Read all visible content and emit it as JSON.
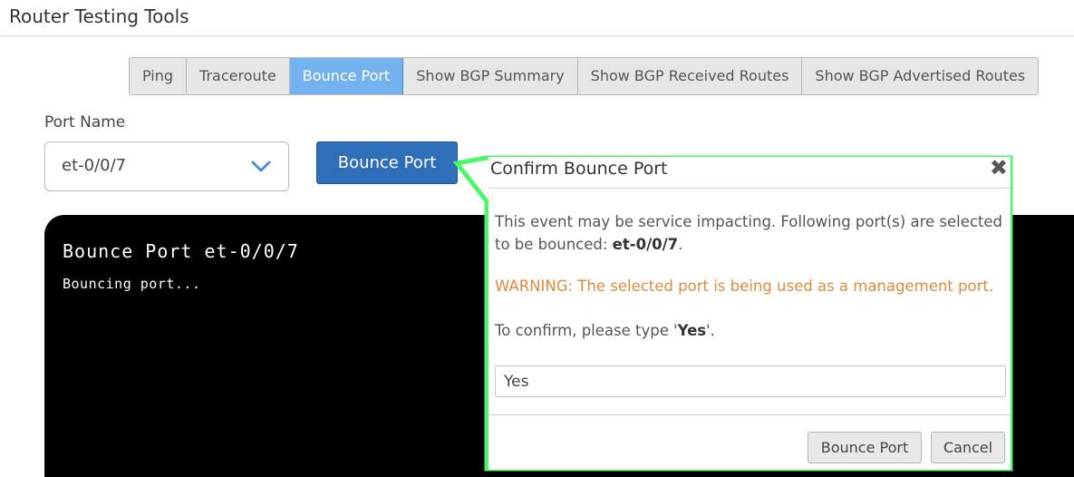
{
  "page": {
    "title": "Router Testing Tools"
  },
  "tabs": [
    {
      "label": "Ping",
      "active": false
    },
    {
      "label": "Traceroute",
      "active": false
    },
    {
      "label": "Bounce Port",
      "active": true
    },
    {
      "label": "Show BGP Summary",
      "active": false
    },
    {
      "label": "Show BGP Received Routes",
      "active": false
    },
    {
      "label": "Show BGP Advertised Routes",
      "active": false
    }
  ],
  "form": {
    "port_label": "Port Name",
    "port_value": "et-0/0/7",
    "bounce_button": "Bounce Port"
  },
  "terminal": {
    "command": "Bounce Port et-0/0/7",
    "output": "Bouncing port..."
  },
  "dialog": {
    "title": "Confirm Bounce Port",
    "close_glyph": "✖",
    "message_prefix": "This event may be service impacting. Following port(s) are selected to be bounced: ",
    "message_port": "et-0/0/7",
    "message_suffix": ".",
    "warning": "WARNING: The selected port is being used as a management port.",
    "confirm_prefix": "To confirm, please type '",
    "confirm_word": "Yes",
    "confirm_suffix": "'.",
    "input_value": "Yes",
    "bounce_button": "Bounce Port",
    "cancel_button": "Cancel"
  },
  "colors": {
    "active_tab": "#74b3ef",
    "primary_button": "#2f6eb8",
    "warning_text": "#e08a3a",
    "highlight_callout": "#4cf56a",
    "terminal_bg": "#000000"
  }
}
